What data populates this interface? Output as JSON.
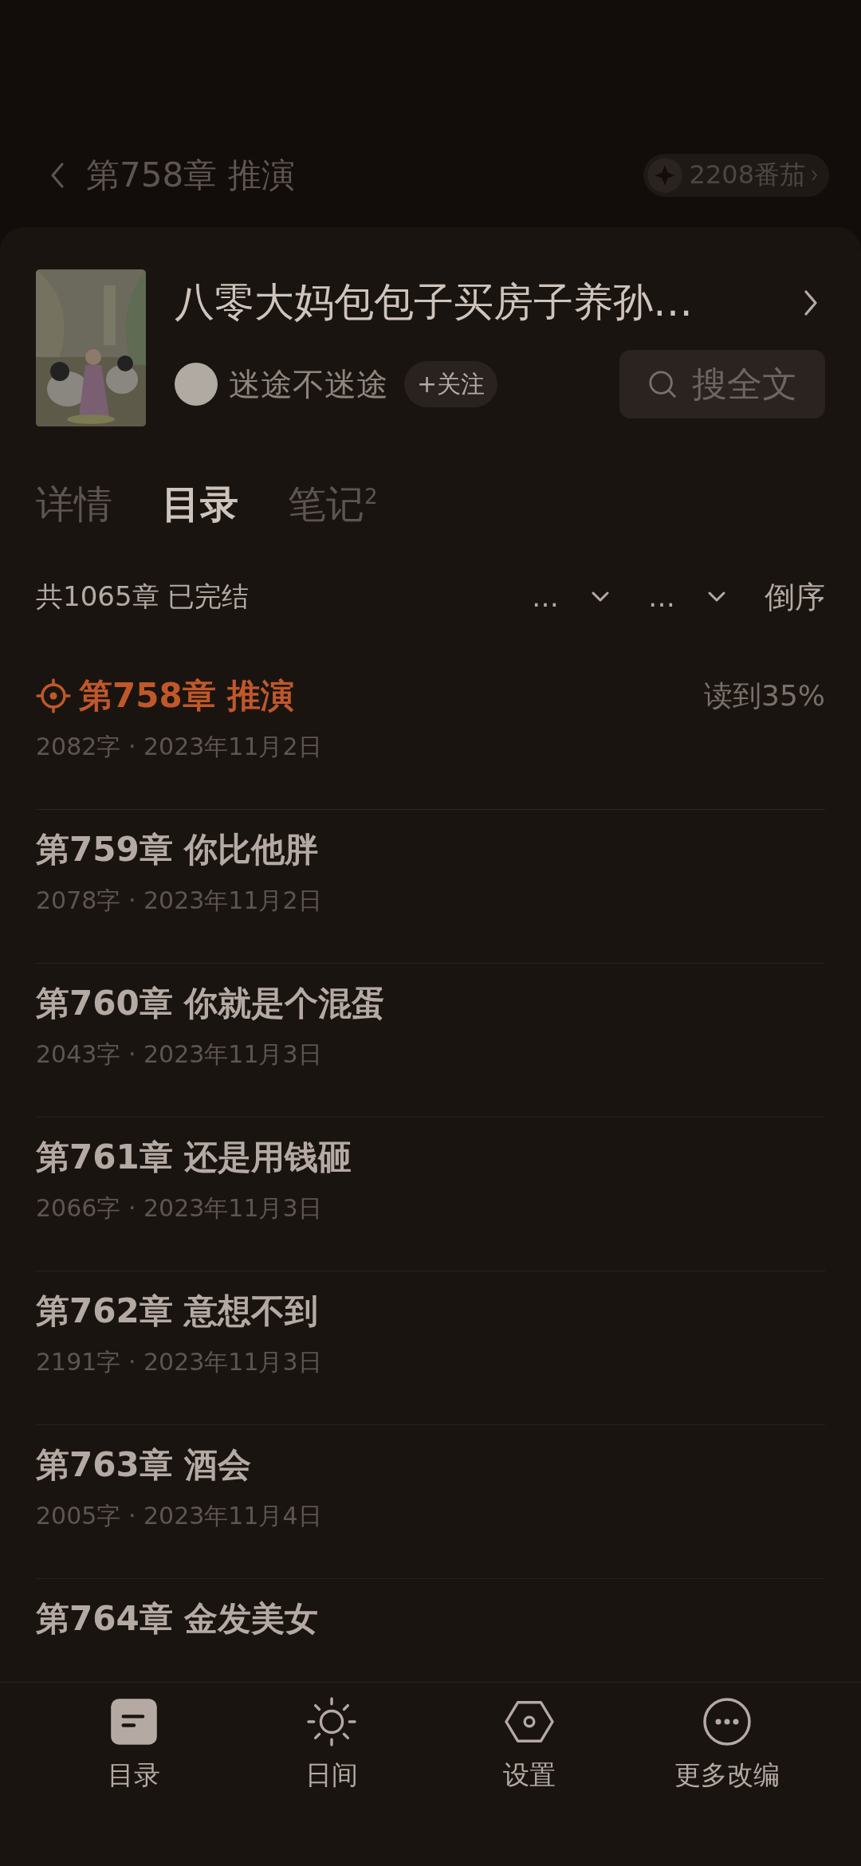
{
  "header": {
    "title": "第758章 推演",
    "coins": "2208番茄"
  },
  "book": {
    "kind": "picture",
    "title": "八零大妈包包子买房子养孙…",
    "author": "迷途不迷途",
    "follow": "+关注",
    "search": "搜全文"
  },
  "tabs": [
    {
      "label": "详情",
      "selected": false
    },
    {
      "label": "目录",
      "selected": true
    },
    {
      "label": "笔记$^{2}$",
      "selected": false
    }
  ],
  "filter": {
    "summary": "共1065章 已完结",
    "dropdowns": [
      "…",
      "…"
    ],
    "sort": "倒序"
  },
  "chapters": [
    {
      "title": "第758章 推演",
      "meta": "2082字 · 2023年11月2日",
      "current": true,
      "progress": "读到35%"
    },
    {
      "title": "第759章 你比他胖",
      "meta": "2078字 · 2023年11月2日",
      "current": false
    },
    {
      "title": "第760章 你就是个混蛋",
      "meta": "2043字 · 2023年11月3日",
      "current": false
    },
    {
      "title": "第761章 还是用钱砸",
      "meta": "2066字 · 2023年11月3日",
      "current": false
    },
    {
      "title": "第762章 意想不到",
      "meta": "2191字 · 2023年11月3日",
      "current": false
    },
    {
      "title": "第763章 酒会",
      "meta": "2005字 · 2023年11月4日",
      "current": false
    },
    {
      "title": "第764章 金发美女",
      "current": false
    }
  ],
  "bottom_bar": [
    {
      "kind": "contents",
      "label": "目录"
    },
    {
      "kind": "day",
      "label": "日间"
    },
    {
      "kind": "settings",
      "label": "设置"
    },
    {
      "kind": "more",
      "label": "更多改编"
    }
  ]
}
